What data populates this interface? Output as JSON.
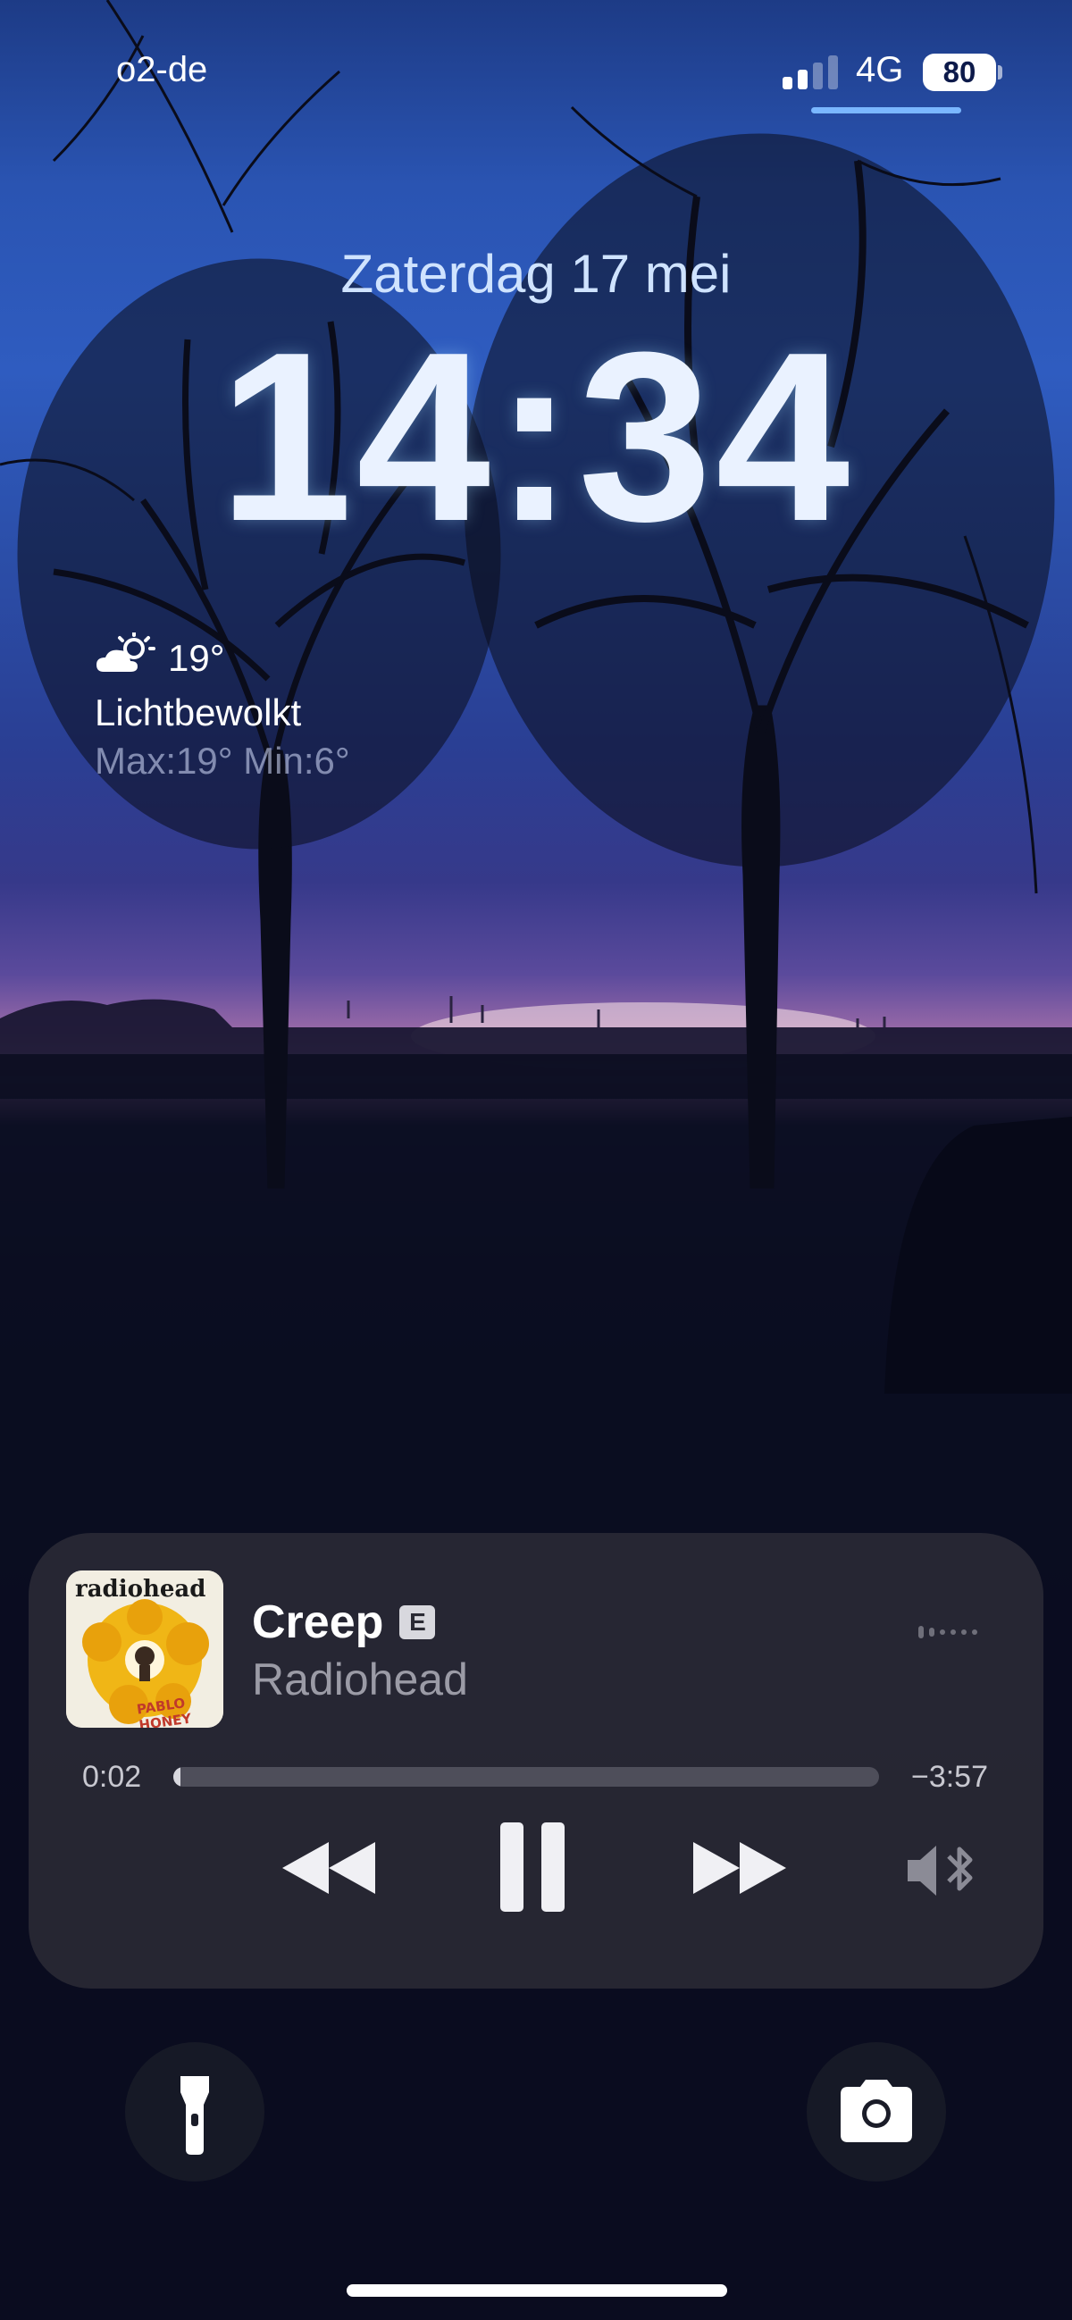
{
  "status_bar": {
    "carrier": "o2-de",
    "network": "4G",
    "battery": "80",
    "signal_bars_active": 2,
    "signal_bars_total": 4
  },
  "lock_screen": {
    "date": "Zaterdag 17 mei",
    "time": "14:34"
  },
  "weather": {
    "icon": "partly-cloudy-icon",
    "temperature": "19°",
    "condition": "Lichtbewolkt",
    "max_min": "Max:19° Min:6°"
  },
  "now_playing": {
    "album_band": "radiohead",
    "album_title": "PABLO HONEY",
    "title": "Creep",
    "explicit_badge": "E",
    "artist": "Radiohead",
    "elapsed": "0:02",
    "remaining": "−3:57",
    "progress": 0.008,
    "controls": {
      "previous": "backward-icon",
      "play_pause": "pause-icon",
      "next": "forward-icon",
      "output": "speaker-bluetooth-icon"
    }
  },
  "quick_actions": {
    "left": "flashlight-icon",
    "right": "camera-icon"
  },
  "colors": {
    "player_bg": "#282834",
    "date_text": "#cfe3ff",
    "signal_active": "#ffffff"
  }
}
